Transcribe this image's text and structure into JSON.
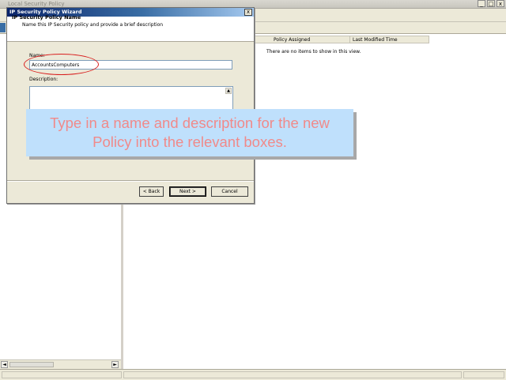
{
  "app": {
    "title": "Local Security Policy",
    "min_glyph": "_",
    "max_glyph": "□",
    "close_glyph": "x"
  },
  "list_view": {
    "columns": [
      "",
      "Policy Assigned",
      "Last Modified Time"
    ],
    "empty_text": "There are no items to show in this view."
  },
  "scroll": {
    "left_glyph": "◄",
    "right_glyph": "►"
  },
  "wizard": {
    "title": "IP Security Policy Wizard",
    "close_glyph": "x",
    "heading": "IP Security Policy Name",
    "subheading": "Name this IP Security policy and provide a brief description",
    "name_label": "Name:",
    "name_value": "AccountsComputers",
    "description_label": "Description:",
    "description_value": "",
    "buttons": {
      "back": "< Back",
      "next": "Next >",
      "cancel": "Cancel"
    }
  },
  "callout": {
    "text": "Type in a name and description for the new Policy into the relevant boxes."
  }
}
